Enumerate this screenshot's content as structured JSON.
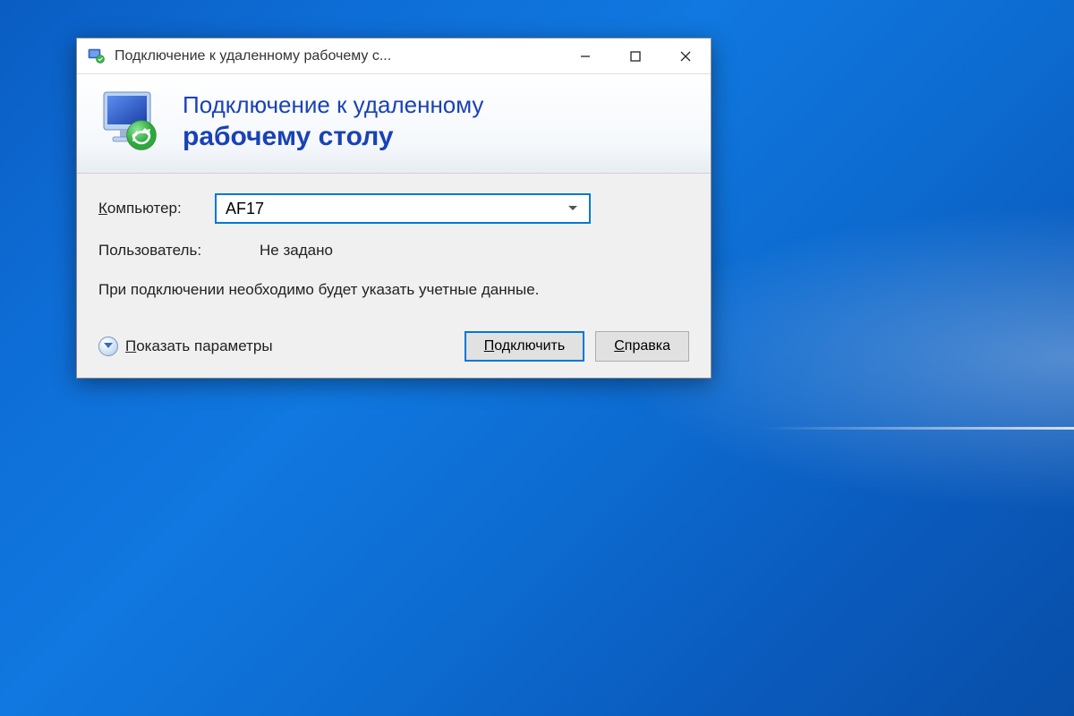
{
  "window": {
    "title": "Подключение к удаленному рабочему с..."
  },
  "header": {
    "line1": "Подключение к удаленному",
    "line2": "рабочему столу"
  },
  "form": {
    "computerLabelPrefix": "К",
    "computerLabelRest": "омпьютер:",
    "computerValue": "AF17",
    "userLabel": "Пользователь:",
    "userValue": "Не задано",
    "hint": "При подключении необходимо будет указать учетные данные."
  },
  "footer": {
    "showOptionsPrefix": "П",
    "showOptionsRest": "оказать параметры",
    "connectPrefix": "П",
    "connectRest": "одключить",
    "helpPrefix": "С",
    "helpRest": "правка"
  }
}
